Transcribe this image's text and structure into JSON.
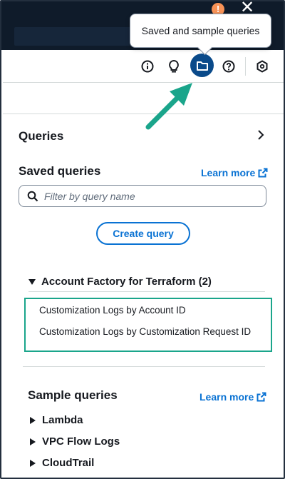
{
  "tooltip": {
    "text": "Saved and sample queries"
  },
  "toolbar": {
    "icons": [
      "info-icon",
      "lightbulb-icon",
      "folder-icon",
      "help-icon",
      "settings-hex-icon"
    ],
    "active_icon": "folder-icon"
  },
  "panel": {
    "queries_title": "Queries",
    "saved_queries": {
      "title": "Saved queries",
      "learn_more": "Learn more",
      "search_placeholder": "Filter by query name",
      "create_button": "Create query",
      "group": {
        "name": "Account Factory for Terraform (2)",
        "items": [
          "Customization Logs by Account ID",
          "Customization Logs by Customization Request ID"
        ]
      }
    },
    "sample_queries": {
      "title": "Sample queries",
      "learn_more": "Learn more",
      "items": [
        "Lambda",
        "VPC Flow Logs",
        "CloudTrail"
      ]
    }
  },
  "colors": {
    "accent": "#0972d3",
    "active_icon_bg": "#0a4a8a",
    "highlight": "#1aa58b",
    "topbar": "#0f1b2a",
    "warning": "#f89256"
  }
}
